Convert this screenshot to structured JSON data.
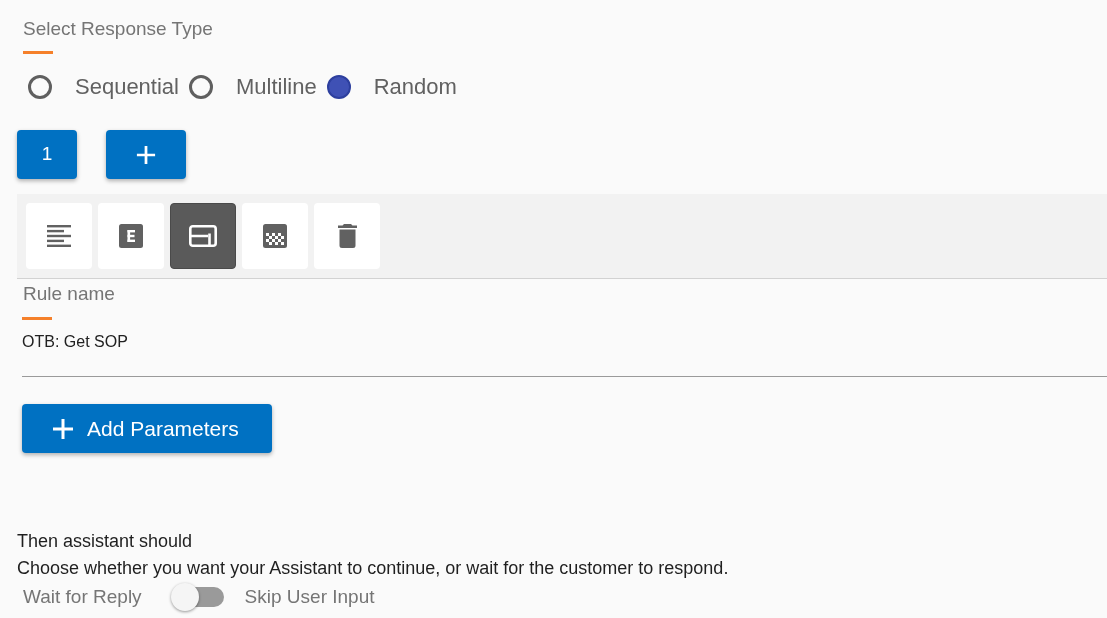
{
  "response_type": {
    "label": "Select Response Type",
    "options": [
      {
        "label": "Sequential",
        "selected": false
      },
      {
        "label": "Multiline",
        "selected": false
      },
      {
        "label": "Random",
        "selected": true
      }
    ]
  },
  "responses": {
    "pages": [
      {
        "label": "1"
      }
    ]
  },
  "toolbar": {
    "buttons": [
      {
        "kind": "text",
        "selected": false
      },
      {
        "kind": "entity",
        "selected": false
      },
      {
        "kind": "card",
        "selected": true
      },
      {
        "kind": "grid",
        "selected": false
      },
      {
        "kind": "delete",
        "selected": false
      }
    ]
  },
  "rule_name": {
    "label": "Rule name",
    "value": "OTB: Get SOP"
  },
  "add_parameters_button": {
    "label": "Add Parameters"
  },
  "then_section": {
    "title": "Then assistant should",
    "description": "Choose whether you want your Assistant to continue, or wait for the customer to respond.",
    "toggle": {
      "off_label": "Wait for Reply",
      "on_label": "Skip User Input",
      "on": false
    }
  }
}
